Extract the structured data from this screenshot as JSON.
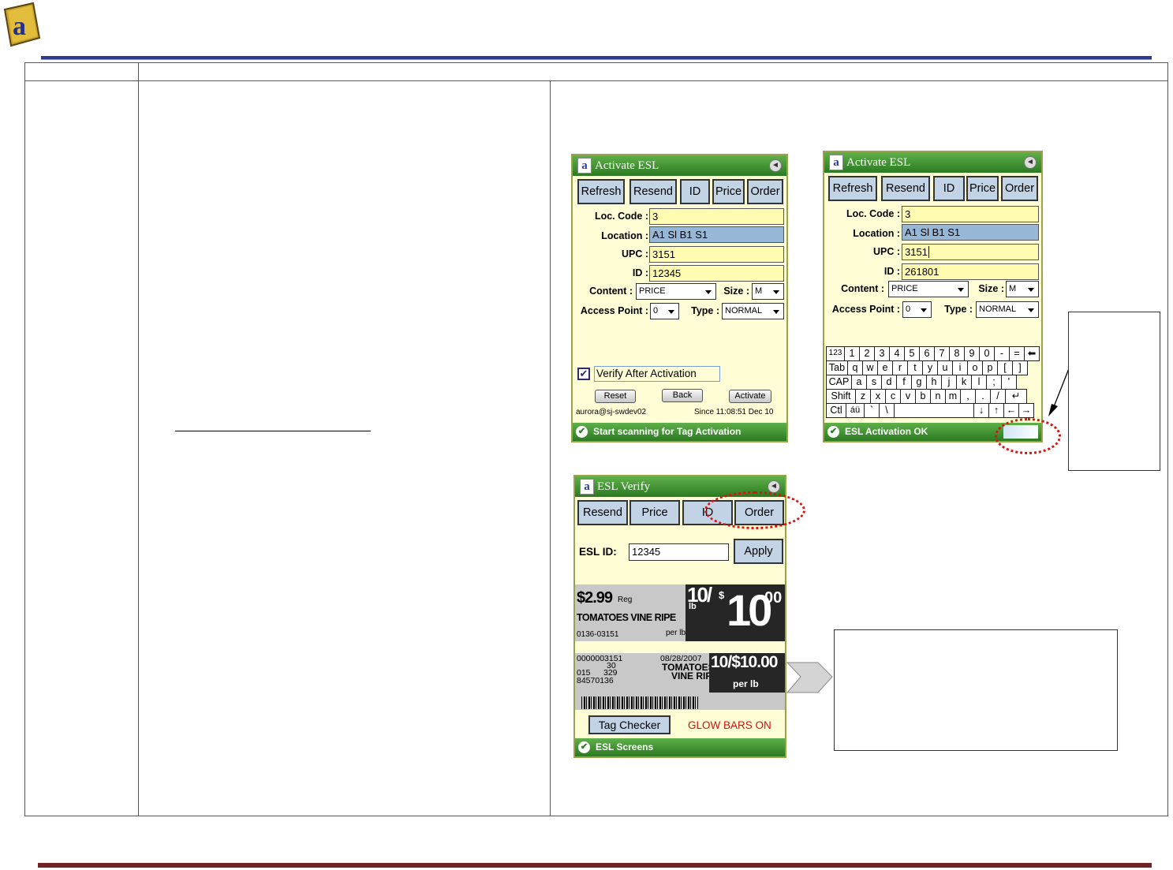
{
  "header": {
    "logo_letter": "a"
  },
  "screen1": {
    "title": "Activate ESL",
    "buttons": [
      "Refresh",
      "Resend",
      "ID",
      "Price",
      "Order"
    ],
    "loc_code_label": "Loc. Code :",
    "loc_code_value": "3",
    "location_label": "Location :",
    "location_value": "A1 Sl B1 S1",
    "upc_label": "UPC :",
    "upc_value": "3151",
    "id_label": "ID :",
    "id_value": "12345",
    "content_label": "Content :",
    "content_value": "PRICE",
    "size_label": "Size :",
    "size_value": "M",
    "ap_label": "Access Point :",
    "ap_value": "0",
    "type_label": "Type :",
    "type_value": "NORMAL",
    "verify_label": "Verify After Activation",
    "reset_label": "Reset",
    "back_label": "Back",
    "activate_label": "Activate",
    "user": "aurora@sj-swdev02",
    "since": "Since 11:08:51 Dec 10",
    "status": "Start scanning for Tag Activation"
  },
  "screen2": {
    "title": "Activate ESL",
    "buttons": [
      "Refresh",
      "Resend",
      "ID",
      "Price",
      "Order"
    ],
    "loc_code_label": "Loc. Code :",
    "loc_code_value": "3",
    "location_label": "Location :",
    "location_value": "A1 Sl B1 S1",
    "upc_label": "UPC :",
    "upc_value": "3151",
    "id_label": "ID :",
    "id_value": "261801",
    "content_label": "Content :",
    "content_value": "PRICE",
    "size_label": "Size :",
    "size_value": "M",
    "ap_label": "Access Point :",
    "ap_value": "0",
    "type_label": "Type :",
    "type_value": "NORMAL",
    "keyboard": [
      [
        "123",
        "1",
        "2",
        "3",
        "4",
        "5",
        "6",
        "7",
        "8",
        "9",
        "0",
        "-",
        "=",
        "⬅"
      ],
      [
        "Tab",
        "q",
        "w",
        "e",
        "r",
        "t",
        "y",
        "u",
        "i",
        "o",
        "p",
        "[",
        "]"
      ],
      [
        "CAP",
        "a",
        "s",
        "d",
        "f",
        "g",
        "h",
        "j",
        "k",
        "l",
        ";",
        "'"
      ],
      [
        "Shift",
        "z",
        "x",
        "c",
        "v",
        "b",
        "n",
        "m",
        ",",
        ".",
        "/",
        "↵"
      ],
      [
        "Ctl",
        "áü",
        "`",
        "\\",
        " ",
        "↓",
        "↑",
        "←",
        "→"
      ]
    ],
    "status": "ESL Activation OK"
  },
  "screen3": {
    "title": "ESL Verify",
    "buttons": [
      "Resend",
      "Price",
      "ID",
      "Order"
    ],
    "esl_id_label": "ESL ID:",
    "esl_id_value": "12345",
    "apply_label": "Apply",
    "tag1": {
      "reg_price": "$2.99",
      "reg_label": "Reg",
      "product": "TOMATOES VINE RIPE",
      "code": "0136-03151",
      "unit": "per lb",
      "deal_qty": "10/",
      "deal_unit": "lb",
      "deal_price_main": "10",
      "deal_price_cents": "00",
      "dollar_sign": "$"
    },
    "tag2": {
      "barcode_no": "0000003151",
      "line2": "30",
      "line3a": "015",
      "line3b": "329",
      "line4": "84570136",
      "date": "08/28/2007",
      "product1": "TOMATOES",
      "product2": "VINE RIPE",
      "deal": "10/$10.00",
      "unit": "per lb"
    },
    "tag_checker_label": "Tag Checker",
    "glow_label": "GLOW BARS ON",
    "status": "ESL Screens"
  }
}
